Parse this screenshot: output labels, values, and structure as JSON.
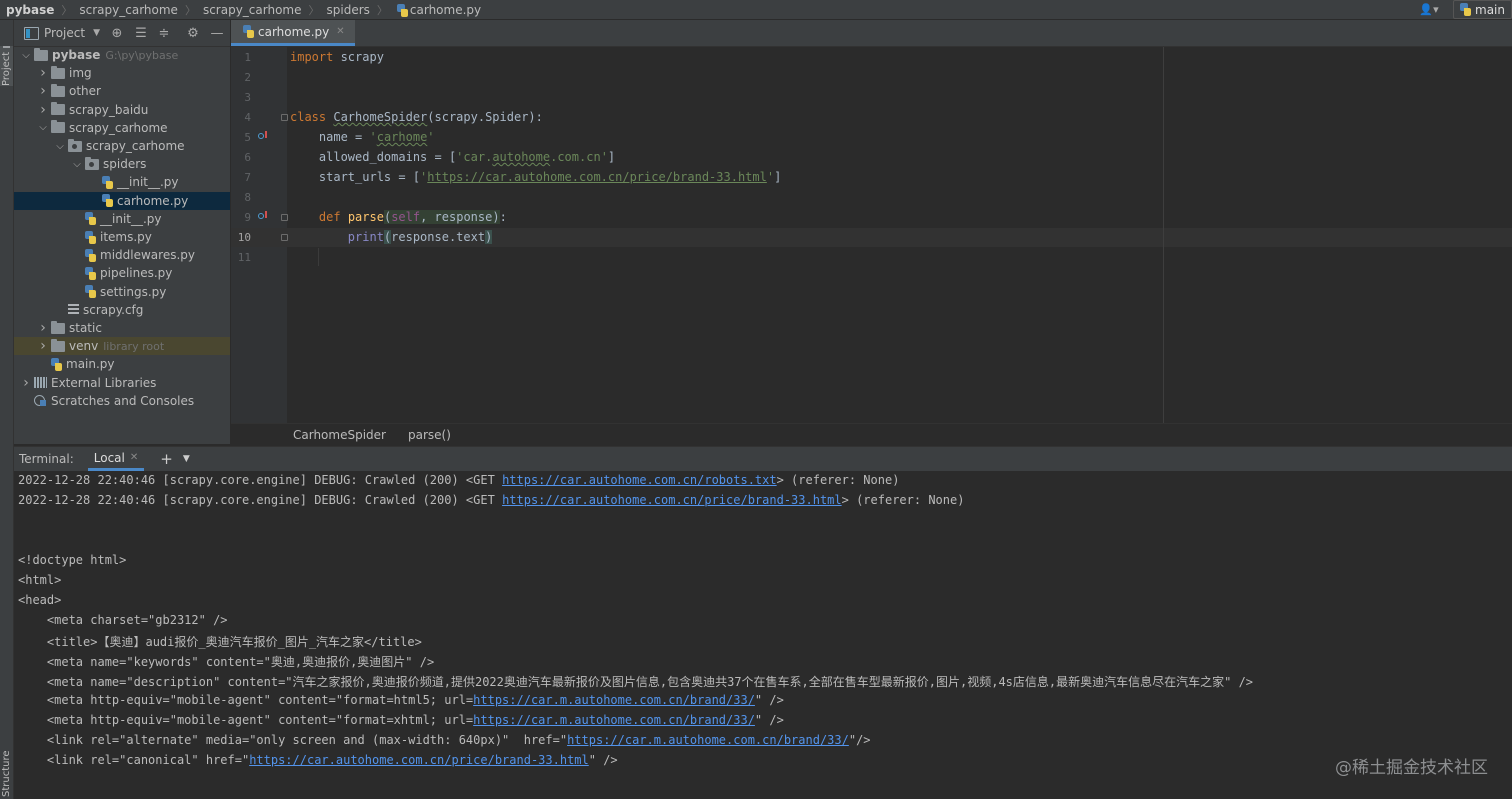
{
  "breadcrumb": [
    "pybase",
    "scrapy_carhome",
    "scrapy_carhome",
    "spiders",
    "carhome.py"
  ],
  "run_config": "main",
  "side_tabs": {
    "project": "Project",
    "structure": "Structure"
  },
  "project_panel": {
    "title": "Project",
    "tree": [
      {
        "label": "pybase",
        "hint": "G:\\py\\pybase",
        "depth": 0,
        "type": "folder",
        "expanded": true,
        "bold": true
      },
      {
        "label": "img",
        "depth": 1,
        "type": "folder",
        "expanded": false
      },
      {
        "label": "other",
        "depth": 1,
        "type": "folder",
        "expanded": false
      },
      {
        "label": "scrapy_baidu",
        "depth": 1,
        "type": "folder",
        "expanded": false
      },
      {
        "label": "scrapy_carhome",
        "depth": 1,
        "type": "folder",
        "expanded": true
      },
      {
        "label": "scrapy_carhome",
        "depth": 2,
        "type": "package",
        "expanded": true
      },
      {
        "label": "spiders",
        "depth": 3,
        "type": "package",
        "expanded": true
      },
      {
        "label": "__init__.py",
        "depth": 4,
        "type": "py"
      },
      {
        "label": "carhome.py",
        "depth": 4,
        "type": "py",
        "selected": true
      },
      {
        "label": "__init__.py",
        "depth": 3,
        "type": "py"
      },
      {
        "label": "items.py",
        "depth": 3,
        "type": "py"
      },
      {
        "label": "middlewares.py",
        "depth": 3,
        "type": "py"
      },
      {
        "label": "pipelines.py",
        "depth": 3,
        "type": "py"
      },
      {
        "label": "settings.py",
        "depth": 3,
        "type": "py"
      },
      {
        "label": "scrapy.cfg",
        "depth": 2,
        "type": "cfg"
      },
      {
        "label": "static",
        "depth": 1,
        "type": "folder",
        "expanded": false
      },
      {
        "label": "venv",
        "hint": "library root",
        "depth": 1,
        "type": "folder",
        "expanded": false,
        "highlight": true
      },
      {
        "label": "main.py",
        "depth": 1,
        "type": "py"
      },
      {
        "label": "External Libraries",
        "depth": 0,
        "type": "lib",
        "expanded": false
      },
      {
        "label": "Scratches and Consoles",
        "depth": 0,
        "type": "scratch"
      }
    ]
  },
  "editor": {
    "tab": "carhome.py",
    "current_line": 10,
    "line_numbers": [
      "1",
      "2",
      "3",
      "4",
      "5",
      "6",
      "7",
      "8",
      "9",
      "10",
      "11"
    ],
    "code": {
      "import_kw": "import",
      "import_mod": " scrapy",
      "class_kw": "class",
      "class_name": "CarhomeSpider",
      "class_base": "(scrapy.Spider):",
      "name_lhs": "    name = ",
      "name_q1": "'",
      "name_val": "carhome",
      "name_q2": "'",
      "domains_lhs": "    allowed_domains = [",
      "domains_q1": "'",
      "domains_val1": "car.",
      "domains_val2": "autohome",
      "domains_val3": ".com.cn",
      "domains_q2": "'",
      "domains_end": "]",
      "urls_lhs": "    start_urls = [",
      "urls_q1": "'",
      "urls_val": "https://car.autohome.com.cn/price/brand-33.html",
      "urls_q2": "'",
      "urls_end": "]",
      "def_indent": "    ",
      "def_kw": "def",
      "def_sp": " ",
      "def_name": "parse",
      "def_open": "(",
      "def_self": "self",
      "def_params": ", response",
      "def_close": ")",
      "def_colon": ":",
      "print_indent": "        ",
      "print_fn": "print",
      "print_open": "(",
      "print_arg": "response.text",
      "print_close": ")"
    },
    "breadcrumb": [
      "CarhomeSpider",
      "parse()"
    ]
  },
  "terminal": {
    "title": "Terminal:",
    "tab": "Local",
    "lines": [
      {
        "pre": "2022-12-28 22:40:46 [scrapy.core.engine] DEBUG: Crawled (200) <GET ",
        "url": "https://car.autohome.com.cn/robots.txt",
        "post": "> (referer: None)"
      },
      {
        "pre": "2022-12-28 22:40:46 [scrapy.core.engine] DEBUG: Crawled (200) <GET ",
        "url": "https://car.autohome.com.cn/price/brand-33.html",
        "post": "> (referer: None)"
      },
      {
        "pre": "",
        "url": "",
        "post": ""
      },
      {
        "pre": "",
        "url": "",
        "post": ""
      },
      {
        "pre": "<!doctype html>",
        "url": "",
        "post": ""
      },
      {
        "pre": "<html>",
        "url": "",
        "post": ""
      },
      {
        "pre": "<head>",
        "url": "",
        "post": ""
      },
      {
        "pre": "    <meta charset=\"gb2312\" />",
        "url": "",
        "post": ""
      },
      {
        "pre": "    <title>【奥迪】audi报价_奥迪汽车报价_图片_汽车之家</title>",
        "url": "",
        "post": ""
      },
      {
        "pre": "    <meta name=\"keywords\" content=\"奥迪,奥迪报价,奥迪图片\" />",
        "url": "",
        "post": ""
      },
      {
        "pre": "    <meta name=\"description\" content=\"汽车之家报价,奥迪报价频道,提供2022奥迪汽车最新报价及图片信息,包含奥迪共37个在售车系,全部在售车型最新报价,图片,视频,4s店信息,最新奥迪汽车信息尽在汽车之家\" />",
        "url": "",
        "post": ""
      },
      {
        "pre": "    <meta http-equiv=\"mobile-agent\" content=\"format=html5; url=",
        "url": "https://car.m.autohome.com.cn/brand/33/",
        "post": "\" />"
      },
      {
        "pre": "    <meta http-equiv=\"mobile-agent\" content=\"format=xhtml; url=",
        "url": "https://car.m.autohome.com.cn/brand/33/",
        "post": "\" />"
      },
      {
        "pre": "    <link rel=\"alternate\" media=\"only screen and (max-width: 640px)\"  href=\"",
        "url": "https://car.m.autohome.com.cn/brand/33/",
        "post": "\"/>"
      },
      {
        "pre": "    <link rel=\"canonical\" href=\"",
        "url": "https://car.autohome.com.cn/price/brand-33.html",
        "post": "\" />"
      }
    ]
  },
  "watermark": "@稀土掘金技术社区"
}
